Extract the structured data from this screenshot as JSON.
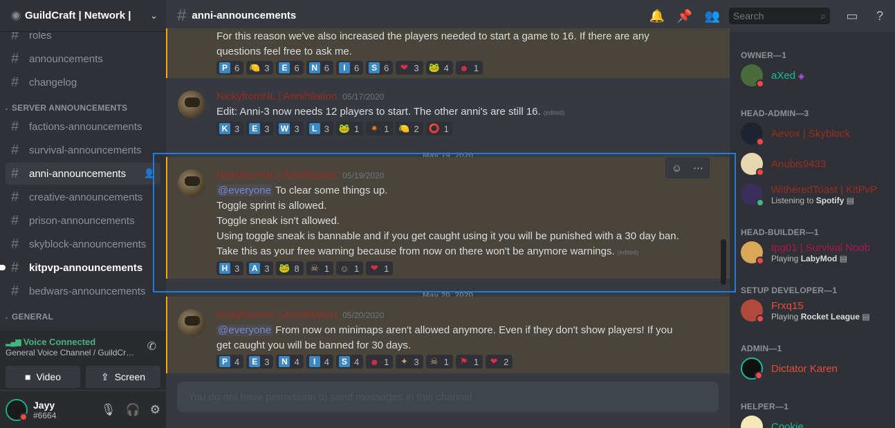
{
  "server": {
    "name": "GuildCraft | Network |",
    "icon": "server-icon"
  },
  "channels_top": [
    {
      "name": "roles"
    },
    {
      "name": "announcements"
    },
    {
      "name": "changelog"
    }
  ],
  "category_server_announcements": "SERVER ANNOUNCEMENTS",
  "channels": [
    {
      "name": "factions-announcements"
    },
    {
      "name": "survival-announcements"
    },
    {
      "name": "anni-announcements"
    },
    {
      "name": "creative-announcements"
    },
    {
      "name": "prison-announcements"
    },
    {
      "name": "skyblock-announcements"
    },
    {
      "name": "kitpvp-announcements"
    },
    {
      "name": "bedwars-announcements"
    }
  ],
  "category_general": "GENERAL",
  "voice": {
    "status": "Voice Connected",
    "channel": "General Voice Channel / GuildCraft | Network |",
    "video_label": "Video",
    "screen_label": "Screen"
  },
  "user": {
    "name": "Jayy",
    "tag": "#6664"
  },
  "chat": {
    "channel_name": "anni-announcements",
    "search_placeholder": "Search",
    "composer_placeholder": "You do not have permission to send messages in this channel."
  },
  "messages": [
    {
      "lines": [
        "For this reason we've also increased the players needed to start a game to 16. If there are any",
        "questions feel free to ask me."
      ],
      "reactions": [
        {
          "e": "P",
          "n": "6"
        },
        {
          "e": "🍋",
          "n": "3"
        },
        {
          "e": "E",
          "n": "6"
        },
        {
          "e": "N",
          "n": "6"
        },
        {
          "e": "I",
          "n": "6"
        },
        {
          "e": "S",
          "n": "6"
        },
        {
          "e": "❤",
          "n": "3"
        },
        {
          "e": "🐸",
          "n": "4"
        },
        {
          "e": "☻",
          "n": "1"
        }
      ]
    },
    {
      "author": "NickyfromNL | Annihilation",
      "time": "05/17/2020",
      "lines": [
        "Edit: Anni-3 now needs 12 players to start. The other anni's are still 16."
      ],
      "edited": "(edited)",
      "reactions": [
        {
          "e": "K",
          "n": "3"
        },
        {
          "e": "E",
          "n": "3"
        },
        {
          "e": "W",
          "n": "3"
        },
        {
          "e": "L",
          "n": "3"
        },
        {
          "e": "🐸",
          "n": "1"
        },
        {
          "e": "✷",
          "n": "1"
        },
        {
          "e": "🍋",
          "n": "2"
        },
        {
          "e": "⭕",
          "n": "1"
        }
      ]
    },
    {
      "date_divider": "May 19, 2020",
      "author": "NickyfromNL | Annihilation",
      "time": "05/19/2020",
      "mention": "@everyone",
      "first_line": " To clear some things up.",
      "lines": [
        "Toggle sprint is allowed.",
        "Toggle sneak isn't allowed.",
        "Using toggle sneak is bannable and if you get caught using it you will be punished with a 30 day ban.",
        "Take this as your free warning because from now on there won't be anymore warnings."
      ],
      "edited": "(edited)",
      "reactions": [
        {
          "e": "H",
          "n": "3"
        },
        {
          "e": "A",
          "n": "3"
        },
        {
          "e": "🐸",
          "n": "8"
        },
        {
          "e": "☠",
          "n": "1"
        },
        {
          "e": "☺",
          "n": "1"
        },
        {
          "e": "❤",
          "n": "1"
        }
      ]
    },
    {
      "date_divider": "May 20, 2020",
      "author": "NickyfromNL | Annihilation",
      "time": "05/20/2020",
      "mention": "@everyone",
      "first_line": " From now on minimaps aren't allowed anymore. Even if they don't show players! If you",
      "lines": [
        "get caught you will be banned for 30 days."
      ],
      "reactions": [
        {
          "e": "P",
          "n": "4"
        },
        {
          "e": "E",
          "n": "3"
        },
        {
          "e": "N",
          "n": "4"
        },
        {
          "e": "I",
          "n": "4"
        },
        {
          "e": "S",
          "n": "4"
        },
        {
          "e": "☻",
          "n": "1"
        },
        {
          "e": "✦",
          "n": "3"
        },
        {
          "e": "☠",
          "n": "1"
        },
        {
          "e": "⚑",
          "n": "1"
        },
        {
          "e": "❤",
          "n": "2"
        }
      ]
    }
  ],
  "members": {
    "roles": [
      {
        "label": "OWNER—1"
      },
      {
        "label": "HEAD-ADMIN—3"
      },
      {
        "label": "HEAD-BUILDER—1"
      },
      {
        "label": "SETUP DEVELOPER—1"
      },
      {
        "label": "ADMIN—1"
      },
      {
        "label": "HELPER—1"
      }
    ],
    "list": [
      {
        "name": "aXed",
        "color": "#1abc9c"
      },
      {
        "name": "Aevox | Skyblock",
        "color": "#992d22"
      },
      {
        "name": "Anubis9433",
        "color": "#992d22"
      },
      {
        "name": "WitheredToast | KitPvP",
        "color": "#992d22",
        "activity_prefix": "Listening to ",
        "activity": "Spotify"
      },
      {
        "name": "tpg01 | Survival Noob",
        "color": "#ad1457",
        "activity_prefix": "Playing ",
        "activity": "LabyMod"
      },
      {
        "name": "Frxq15",
        "color": "#e74c3c",
        "activity_prefix": "Playing ",
        "activity": "Rocket League"
      },
      {
        "name": "Dictator Karen",
        "color": "#e74c3c"
      },
      {
        "name": "Cookie",
        "color": "#1abc9c"
      }
    ]
  },
  "colors": {
    "accent": "#7289da",
    "highlight_bar": "#faa61a",
    "selection": "#1e7de0"
  }
}
